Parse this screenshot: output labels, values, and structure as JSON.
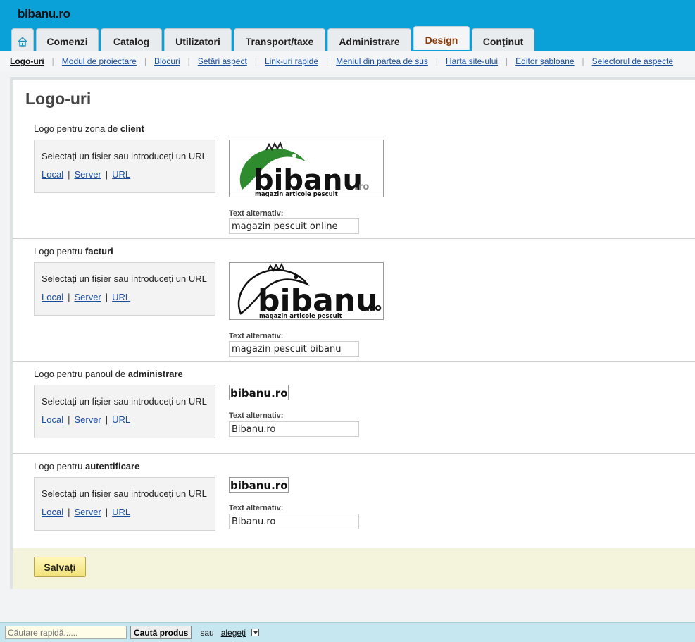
{
  "header": {
    "brand": "bibanu.ro",
    "tabs": [
      {
        "label": "Comenzi"
      },
      {
        "label": "Catalog"
      },
      {
        "label": "Utilizatori"
      },
      {
        "label": "Transport/taxe"
      },
      {
        "label": "Administrare"
      },
      {
        "label": "Design",
        "active": true
      },
      {
        "label": "Conținut"
      }
    ]
  },
  "subnav": {
    "items": [
      "Logo-uri",
      "Modul de proiectare",
      "Blocuri",
      "Setări aspect",
      "Link-uri rapide",
      "Meniul din partea de sus",
      "Harta site-ului",
      "Editor șabloane",
      "Selectorul de aspecte"
    ]
  },
  "main": {
    "title": "Logo-uri",
    "alt_label": "Text alternativ:",
    "upload_prompt": "Selectați un fișier sau introduceți un URL",
    "link_local": "Local",
    "link_server": "Server",
    "link_url": "URL",
    "sections": [
      {
        "prefix": "Logo pentru zona de ",
        "bold": "client",
        "alt_text": "magazin pescuit online",
        "logo": {
          "word": "bibanu",
          "suffix": ".ro",
          "tagline": "magazin articole pescuit"
        }
      },
      {
        "prefix": "Logo pentru ",
        "bold": "facturi",
        "alt_text": "magazin pescuit bibanu",
        "logo": {
          "word": "bibanu",
          "suffix": ".ro",
          "tagline": "magazin articole pescuit"
        }
      },
      {
        "prefix": "Logo pentru panoul de ",
        "bold": "administrare",
        "alt_text": "Bibanu.ro",
        "logo": {
          "word": "bibanu.ro"
        }
      },
      {
        "prefix": "Logo pentru ",
        "bold": "autentificare",
        "alt_text": "Bibanu.ro",
        "logo": {
          "word": "bibanu.ro"
        }
      }
    ],
    "save_label": "Salvați"
  },
  "footer": {
    "search_placeholder": "Căutare rapidă......",
    "search_button": "Caută produs",
    "or_text": "sau",
    "choose_link": "alegeți"
  },
  "colors": {
    "header_bg": "#0aa0d8",
    "active_tab_text": "#8a3a0a",
    "link": "#1a4fa0",
    "save_bar_bg": "#f4f4dc",
    "fish_green": "#2e8b2e"
  },
  "icons": {
    "home": "home-icon",
    "dropdown": "chevron-down-icon"
  }
}
